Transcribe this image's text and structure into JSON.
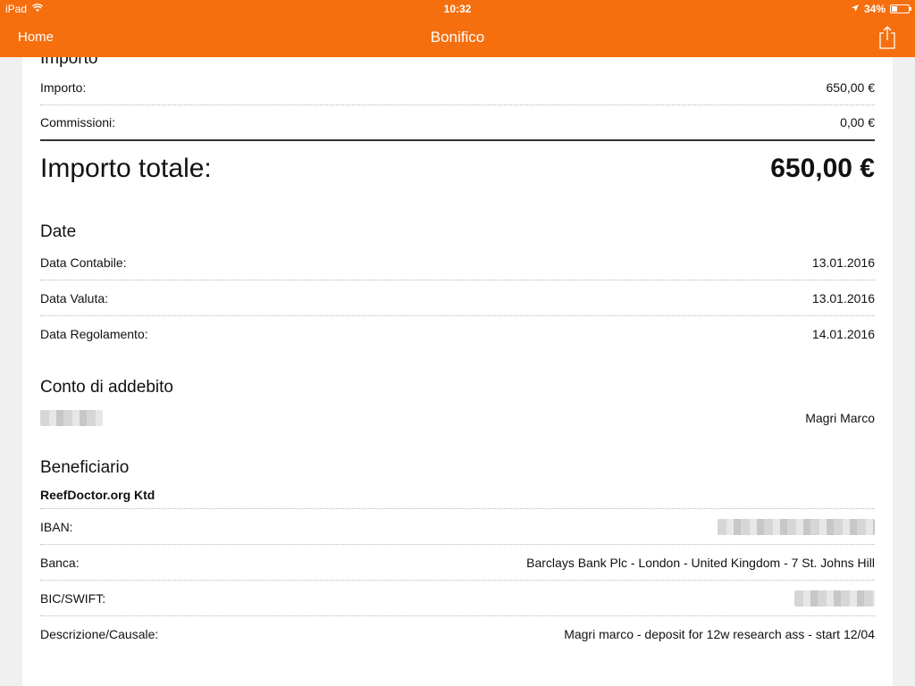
{
  "status_bar": {
    "device": "iPad",
    "time": "10:32",
    "battery": "34%",
    "battery_level": 0.34
  },
  "nav": {
    "back_label": "Home",
    "title": "Bonifico"
  },
  "importo": {
    "title": "Importo",
    "rows": [
      {
        "label": "Importo:",
        "value": "650,00 €"
      },
      {
        "label": "Commissioni:",
        "value": "0,00 €"
      }
    ],
    "total_label": "Importo totale:",
    "total_value": "650,00 €"
  },
  "date": {
    "title": "Date",
    "rows": [
      {
        "label": "Data Contabile:",
        "value": "13.01.2016"
      },
      {
        "label": "Data Valuta:",
        "value": "13.01.2016"
      },
      {
        "label": "Data Regolamento:",
        "value": "14.01.2016"
      }
    ]
  },
  "conto": {
    "title": "Conto di addebito",
    "holder": "Magri Marco"
  },
  "beneficiario": {
    "title": "Beneficiario",
    "name": "ReefDoctor.org Ktd",
    "iban_label": "IBAN:",
    "banca_label": "Banca:",
    "banca_value": "Barclays Bank Plc - London - United Kingdom - 7 St. Johns Hill",
    "bic_label": "BIC/SWIFT:",
    "descr_label": "Descrizione/Causale:",
    "descr_value": "Magri marco - deposit for 12w research ass - start 12/04"
  }
}
